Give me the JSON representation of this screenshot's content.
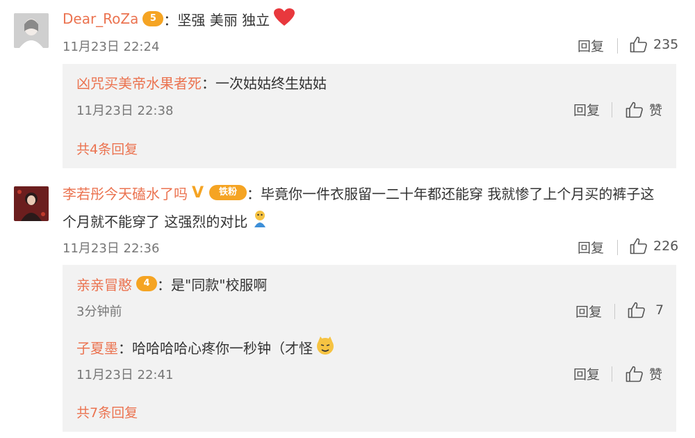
{
  "colors": {
    "username": "#eb7350",
    "reply_bg": "#f2f2f2",
    "badge": "#f5a423",
    "heart": "#e8383d"
  },
  "comments": [
    {
      "username": "Dear_RoZa",
      "badge": "5",
      "colon": "：",
      "text": "坚强 美丽 独立",
      "emoji": "heart",
      "time": "11月23日 22:24",
      "reply_label": "回复",
      "like_count": "235",
      "replies": [
        {
          "username": "凶咒买美帝水果者死",
          "colon": "：",
          "text": "一次姑姑终生姑姑",
          "time": "11月23日 22:38",
          "reply_label": "回复",
          "like_label": "赞"
        }
      ],
      "more_replies": "共4条回复"
    },
    {
      "username": "李若彤今天磕水了吗",
      "verified": "V",
      "badge": "铁粉",
      "colon": "：",
      "text_line1": "毕竟你一件衣服留一二十年都还能穿 我就惨了上个月买的裤子这",
      "text_line2": "个月就不能穿了 这强烈的对比",
      "time": "11月23日 22:36",
      "reply_label": "回复",
      "like_count": "226",
      "replies": [
        {
          "username": "亲亲冒憨",
          "badge": "4",
          "colon": "：",
          "text": "是\"同款\"校服啊",
          "time": "3分钟前",
          "reply_label": "回复",
          "like_count": "7"
        },
        {
          "username": "子夏墨",
          "colon": "：",
          "text": "哈哈哈哈心疼你一秒钟（才怪",
          "time": "11月23日 22:41",
          "reply_label": "回复",
          "like_label": "赞"
        }
      ],
      "more_replies": "共7条回复"
    }
  ]
}
